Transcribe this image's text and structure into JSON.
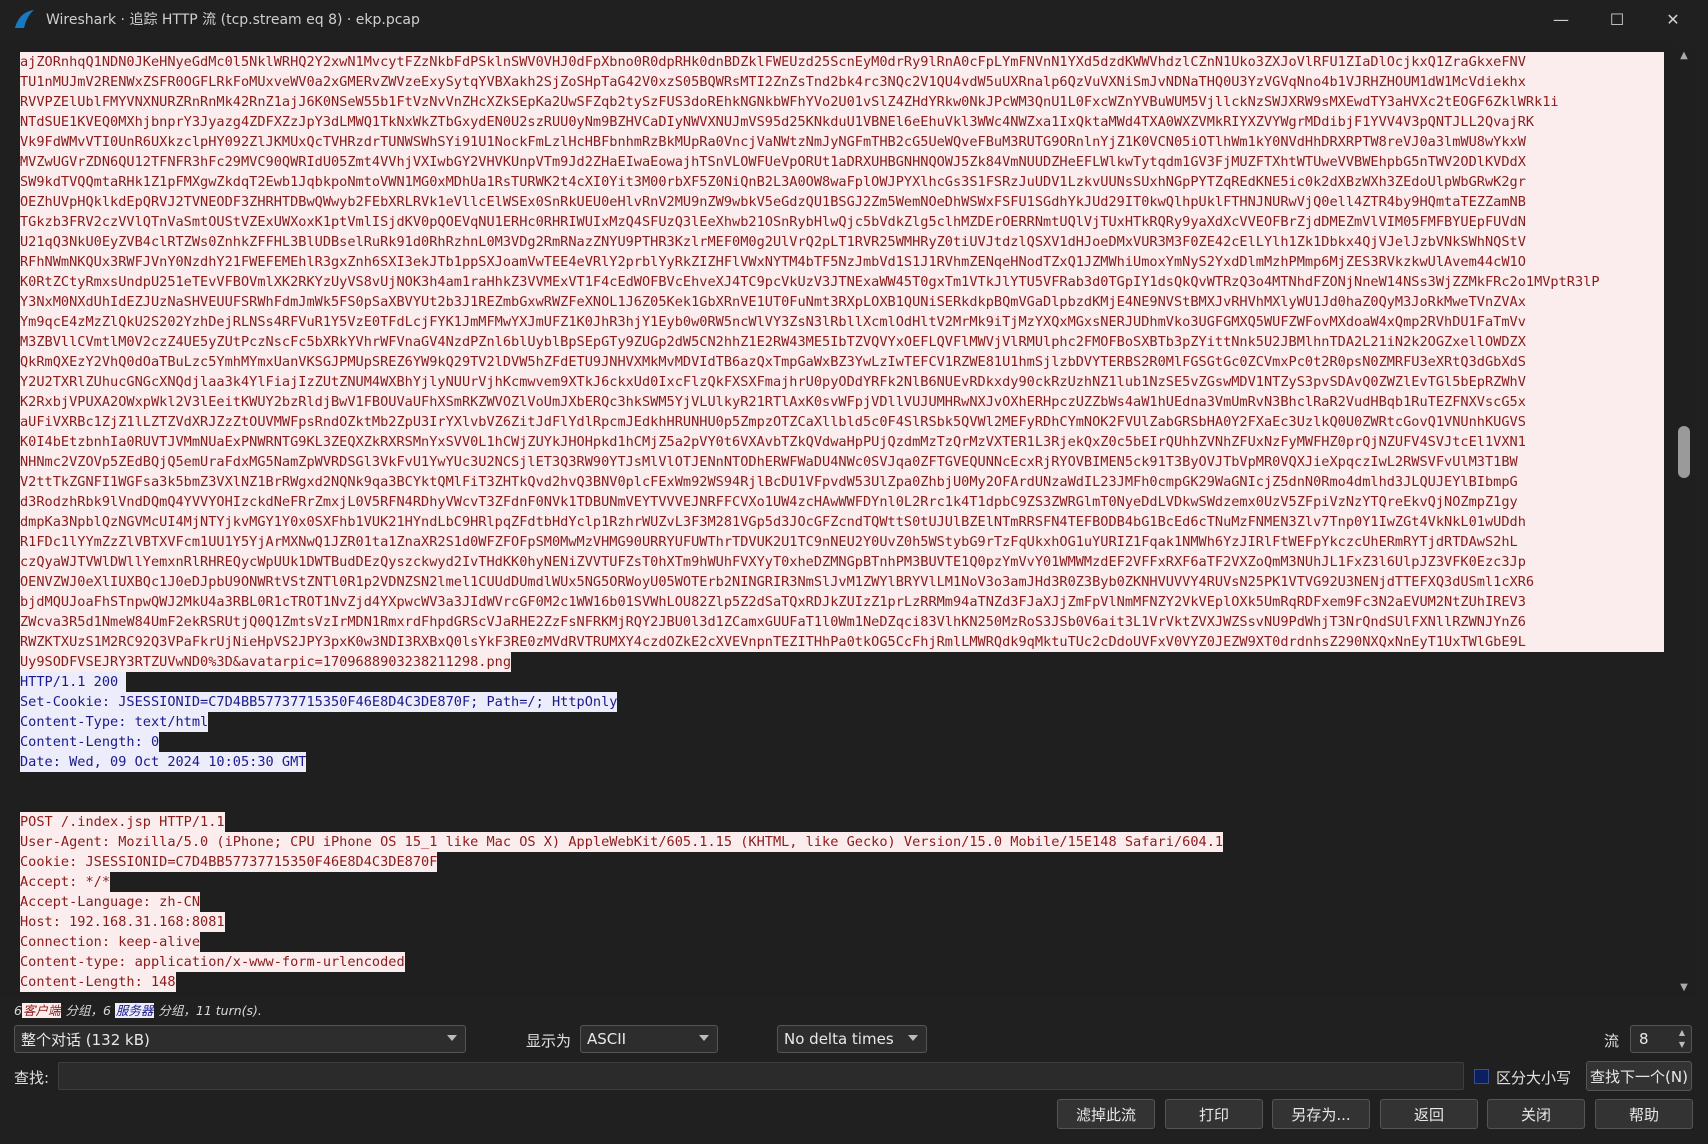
{
  "window": {
    "title": "Wireshark · 追踪 HTTP 流 (tcp.stream eq 8) · ekp.pcap",
    "minimize": "—",
    "maximize": "☐",
    "close": "✕"
  },
  "stream": {
    "client_body_lines": [
      "ajZORnhqQ1NDN0JKeHNyeGdMc0l5NklWRHQ2Y2xwN1MvcytFZzNkbFdPSklnSWV0VHJ0dFpXbno0R0dpRHk0dnBDZklFWEUzd25ScnEyM0drRy9lRnA0cFpLYmFNVnN1YXd5dzdKWWVhdzlCZnN1Uko3ZXJoVlRFU1ZIaDlOcjkxQ1ZraGkxeFNV",
      "TU1nMUJmV2RENWxZSFR0OGFLRkFoMUxveWV0a2xGMERvZWVzeExySytqYVBXakh2SjZoSHpTaG42V0xzS05BQWRsMTI2ZnZsTnd2bk4rc3NQc2V1QU4vdW5uUXRnalp6QzVuVXNiSmJvNDNaTHQ0U3YzVGVqNno4b1VJRHZHOUM1dW1McVdiekhx",
      "RVVPZElUblFMYVNXNURZRnRnMk42RnZ1ajJ6K0NSeW55b1FtVzNvVnZHcXZkSEpKa2UwSFZqb2tySzFUS3doREhkNGNkbWFhYVo2U01vSlZ4ZHdYRkw0NkJPcWM3QnU1L0FxcWZnYVBuWUM5VjllckNzSWJXRW9sMXEwdTY3aHVXc2tEOGF6ZklWRk1i",
      "NTdSUE1KVEQ0MXhjbnprY3Jyazg4ZDFXZzJpY3dLMWQ1TkNxWkZTbGxydEN0U2szRUU0yNm9BZHVCaDIyNWVXNUJmVS95d25KNkduU1VBNEl6eEhuVkl3WWc4NWZxa1IxQktaMWd4TXA0WXZVMkRIYXZVYWgrMDdibjF1YVV4V3pQNTJLL2QvajRK",
      "Vk9FdWMvVTI0UnR6UXkzclpHY092ZlJKMUxQcTVHRzdrTUNWSWhSYi91U1NockFmLzlHcHBFbnhmRzBkMUpRa0VncjVaNWtzNmJyNGFmTHB2cG5UeWQveFBuM3RUTG9ORnlnYjZ1K0VCN05iOTlhWm1kY0NVdHhDRXRPTW8reVJ0a3lmWU8wYkxW",
      "MVZwUGVrZDN6QU12TFNFR3hFc29MVC90QWRIdU05Zmt4VVhjVXIwbGY2VHVKUnpVTm9Jd2ZHaEIwaEowajhTSnVLOWFUeVpORUt1aDRXUHBGNHNQOWJ5Zk84VmNUUDZHeEFLWlkwTytqdm1GV3FjMUZFTXhtWTUweVVBWEhpbG5nTWV2ODlKVDdX",
      "SW9kdTVQQmtaRHk1Z1pFMXgwZkdqT2Ewb1JqbkpoNmtoVWN1MG0xMDhUa1RsTURWK2t4cXI0Yit3M00rbXF5Z0NiQnB2L3A0OW8waFplOWJPYXlhcGs3S1FSRzJuUDV1LzkvUUNsSUxhNGpPYTZqREdKNE5ic0k2dXBzWXh3ZEdoUlpWbGRwK2gr",
      "OEZhUVpHQklkdEpQRVJ2TVNEODF3ZHRHTDBwQWwyb2FEbXRLRVk1eVllcElWSEx0SnRkUEU0eHlvRnV2MU9nZW9wbkV5eGdzQU1BSGJ2Zm5WemNOeDhWSWxFSFU1SGdhYkJUd29IT0kwQlhpUklFTHNJNURwVjQ0ell4ZTR4by9HQmtaTEZZamNB",
      "TGkzb3FRV2czVVlQTnVaSmtOUStVZExUWXoxK1ptVmlISjdKV0pQOEVqNU1ERHc0RHRIWUIxMzQ4SFUzQ3lEeXhwb21OSnRybHlwQjc5bVdkZlg5clhMZDErOERRNmtUQlVjTUxHTkRQRy9yaXdXcVVEOFBrZjdDMEZmVlVIM05FMFBYUEpFUVdN",
      "U21qQ3NkU0EyZVB4clRTZWs0ZnhkZFFHL3BlUDBselRuRk91d0RhRzhnL0M3VDg2RmRNazZNYU9PTHR3KzlrMEF0M0g2UlVrQ2pLT1RVR25WMHRyZ0tiUVJtdzlQSXV1dHJoeDMxVUR3M3F0ZE42cElLYlh1Zk1Dbkx4QjVJelJzbVNkSWhNQStV",
      "RFhNWmNKQUx3RWFJVnY0NzdhY21FWEFEMEhlR3gxZnh6SXI3ekJTb1ppSXJoamVwTEE4eVRlY2prblYyRkZIZHFlVWxNYTM4bTF5NzJmbVd1S1J1RVhmZENqeHNodTZxQ1JZMWhiUmoxYmNyS2YxdDlmMzhPMmp6MjZES3RVkzkwUlAvem44cW1O",
      "K0RtZCtyRmxsUndpU251eTEvVFBOVmlXK2RKYzUyVS8vUjNOK3h4am1raHhkZ3VVMExVT1F4cEdWOFBVcEhveXJ4TC9pcVkUzV3JTNExaWW45T0gxTm1VTkJlYTU5VFRab3d0TGpIY1dsQkQvWTRzQ3o4MTNhdFZONjNneW14NSs3WjZZMkFRc2o1MVptR3lP",
      "Y3NxM0NXdUhIdEZJUzNaSHVEUUFSRWhFdmJmWk5FS0pSaXBVYUt2b3J1REZmbGxwRWZFeXNOL1J6Z05Kek1GbXRnVE1UT0FuNmt3RXpLOXB1QUNiSERkdkpBQmVGaDlpbzdKMjE4NE9NVStBMXJvRHVhMXlyWU1Jd0haZ0QyM3JoRkMweTVnZVAx",
      "Ym9qcE4zMzZlQkU2S202YzhDejRLNSs4RFVuR1Y5VzE0TFdLcjFYK1JmMFMwYXJmUFZ1K0JhR3hjY1Eyb0w0RW5ncWlVY3ZsN3lRbllXcmlOdHltV2MrMk9iTjMzYXQxMGxsNERJUDhmVko3UGFGMXQ5WUFZWFovMXdoaW4xQmp2RVhDU1FaTmVv",
      "M3ZBVllCVmtlM0V2czZ4UE5yZUtPczNscFc5bXRkYVhrWFVnaGV4NzdPZnl6blUyblBpSEpGTy9ZUGp2dW5CN2hhZ1E2RW43ME5IbTZVQVYxOEFLQVFlMWVjVlRMUlphc2FMOFBoSXBTb3pZYittNnk5U2JBMlhnTDA2L21iN2k2OGZxellOWDZX",
      "QkRmQXEzY2VhQ0dOaTBuLzc5YmhMYmxUanVKSGJPMUpSREZ6YW9kQ29TV2lDVW5hZFdETU9JNHVXMkMvMDVIdTB6azQxTmpGaWxBZ3YwLzIwTEFCV1RZWE81U1hmSjlzbDVYTERBS2R0MlFGSGtGc0ZCVmxPc0t2R0psN0ZMRFU3eXRtQ3dGbXdS",
      "Y2U2TXRlZUhucGNGcXNQdjlaa3k4YlFiajIzZUtZNUM4WXBhYjlyNUUrVjhKcmwvem9XTkJ6ckxUd0IxcFlzQkFXSXFmajhrU0pyODdYRFk2NlB6NUEvRDkxdy90ckRzUzhNZ1lub1NzSE5vZGswMDV1NTZyS3pvSDAvQ0ZWZlEvTGl5bEpRZWhV",
      "K2RxbjVPUXA2OWxpWkl2V3lEeitKWUY2bzRldjBwV1FBOUVaUFhXSmRKZWVOZlVoUmJXbERQc3hkSWM5YjVLUlkyR21RTlAxK0svWFpjVDllVUJUMHRwNXJvOXhERHpczUZZbWs4aW1hUEdna3VmUmRvN3BhclRaR2VudHBqb1RuTEZFNXVscG5x",
      "aUFiVXRBc1ZjZ1lLZTZVdXRJZzZtOUVMWFpsRndOZktMb2ZpU3IrYXlvbVZ6ZitJdFlYdlRpcmJEdkhHRUNHU0p5ZmpzOTZCaXllbld5c0F4SlRSbk5QVWl2MEFyRDhCYmNOK2FVUlZabGRSbHA0Y2FXaEc3UzlkQ0U0ZWRtcGovQ1VNUnhKUGVS",
      "K0I4bEtzbnhIa0RUVTJVMmNUaExPNWRNTG9KL3ZEQXZkRXRSMnYxSVV0L1hCWjZUYkJHOHpkd1hCMjZ5a2pVY0t6VXAvbTZkQVdwaHpPUjQzdmMzTzQrMzVXTER1L3RjekQxZ0c5bEIrQUhhZVNhZFUxNzFyMWFHZ0prQjNZUFV4SVJtcEl1VXN1",
      "NHNmc2VZOVp5ZEdBQjQ5emUraFdxMG5NamZpWVRDSGl3VkFvU1YwYUc3U2NCSjlET3Q3RW90YTJsMlVlOTJENnNTODhERWFWaDU4NWc0SVJqa0ZFTGVEQUNNcEcxRjRYOVBIMEN5ck91T3ByOVJTbVpMR0VQXJieXpqczIwL2RWSVFvUlM3T1BW",
      "V2ttTkZGNFI1WGFsa3k5bmZ3VXlNZ1BrRWgxd2NQNk9qa3BCYktQMlFiT3ZHTkQvd2hvQ3BNV0plcFExWm92WS94RjlBcDU1VFpvdW53UlZpa0ZhbjU0My2OFArdUNzaWdIL23JMFh0cmpGK29WaGNIcjZ5dnN0Rmo4dmlhd3JLQUJEYlBIbmpG",
      "d3RodzhRbk9lVndDQmQ4YVVYOHIzckdNeFRrZmxjL0V5RFN4RDhyVWcvT3ZFdnF0NVk1TDBUNmVEYTVVVEJNRFFCVXo1UW4zcHAwWWFDYnl0L2Rrc1k4T1dpbC9ZS3ZWRGlmT0NyeDdLVDkwSWdzemx0UzV5ZFpiVzNzYTQreEkvQjNOZmpZ1gy",
      "dmpKa3NpblQzNGVMcUI4MjNTYjkvMGY1Y0x0SXFhb1VUK21HYndLbC9HRlpqZFdtbHdYclp1RzhrWUZvL3F3M281VGp5d3JOcGFZcndTQWttS0tUJUlBZElNTmRRSFN4TEFBODB4bG1BcEd6cTNuMzFNMEN3Zlv7Tnp0Y1IwZGt4VkNkL01wUDdh",
      "R1FDc1lYYmZzZlVBTXVFcm1UU1Y5YjArMXNwQ1JZR01ta1ZnaXR2S1d0WFZFOFpSM0MwMzVHMG90URRYUFUWThrTDVUK2U1TC9nNEU2Y0UvZ0h5WStybG9rTzFqUkxhOG1uYURIZ1Fqak1NMWh6YzJIRlFtWEFpYkczcUhERmRYTjdRTDAwS2hL",
      "czQyaWJTVWlDWllYemxnRlRHREQycWpUUk1DWTBudDEzQyszckwyd2IvTHdKK0hyNENiZVVTUFZsT0hXTm9hWUhFVXYyT0xheDZMNGpBTnhPM3BUVTE1Q0pzYmVvY01WMWMzdEF2VFFxRXF6aTF2VXZoQmM3NUhJL1FxZ3l6UlpJZ3VFK0Ezc3Jp",
      "OENVZWJ0eXlIUXBQc1J0eDJpbU9ONWRtVStZNTl0R1p2VDNZSN2lmel1CUUdDUmdlWUx5NG5ORWoyU05WOTErb2NINGRIR3NmSlJvM1ZWYlBRYVlLM1NoV3o3amJHd3R0Z3Byb0ZKNHVUVVY4RUVsN25PK1VTVG92U3NENjdTTEFXQ3dUSml1cXR6",
      "bjdMQUJoaFhSTnpwQWJ2MkU4a3RBL0R1cTROT1NvZjd4YXpwcWV3a3JIdWVrcGF0M2c1WW16b01SVWhLOU82Zlp5Z2dSaTQxRDJkZUIzZ1prLzRRMm94aTNZd3FJaXJjZmFpVlNmMFNZY2VkVEplOXk5UmRqRDFxem9Fc3N2aEVUM2NtZUhIREV3",
      "ZWcva3R5d1NmeW84UmF2ekRSRUtjQ0Q1ZmtsVzIrMDN1RmxrdFhpdGRScVJaRHE2ZzFsNFRKMjRQY2JBU0l3d1ZCamxGUUFaT1l0Wm1NeDZqci83VlhKN250MzRoS3JSb0V6ait3L1VrVktZVXJWZSsvNU9PdWhjT3NrQndSUlFXNllRZWNJYnZ6",
      "RWZKTXUzS1M2RC92Q3VPaFkrUjNieHpVS2JPY3pxK0w3NDI3RXBxQ0lsYkF3RE0zMVdRVTRUMXY4czdOZkE2cXVEVnpnTEZITHhPa0tkOG5CcFhjRmlLMWRQdk9qMktuTUc2cDdoUVFxV0VYZ0JEZW9XT0drdnhsZ290NXQxNnEyT1UxTWlGbE9L",
      "Uy9SODFVSEJRY3RTZUVwND0%3D&avatarpic=1709688903238211298.png"
    ],
    "server_response": [
      "HTTP/1.1 200 ",
      "Set-Cookie: JSESSIONID=C7D4BB57737715350F46E8D4C3DE870F; Path=/; HttpOnly",
      "Content-Type: text/html",
      "Content-Length: 0",
      "Date: Wed, 09 Oct 2024 10:05:30 GMT"
    ],
    "client_request": [
      "POST /.index.jsp HTTP/1.1",
      "User-Agent: Mozilla/5.0 (iPhone; CPU iPhone OS 15_1 like Mac OS X) AppleWebKit/605.1.15 (KHTML, like Gecko) Version/15.0 Mobile/15E148 Safari/604.1",
      "Cookie: JSESSIONID=C7D4BB57737715350F46E8D4C3DE870F",
      "Accept: */*",
      "Accept-Language: zh-CN",
      "Host: 192.168.31.168:8081",
      "Connection: keep-alive",
      "Content-type: application/x-www-form-urlencoded",
      "Content-Length: 148"
    ]
  },
  "status": {
    "client_count": "6",
    "client_tag": "客户端",
    "mid": " 分组，6 ",
    "server_tag": "服务器",
    "tail": " 分组，11 turn(s)."
  },
  "controls": {
    "conversation": "整个对话 (132 kB)",
    "show_as_label": "显示为",
    "show_as_value": "ASCII",
    "delta": "No delta times",
    "stream_label": "流",
    "stream_value": "8",
    "find_label": "查找:",
    "find_value": "",
    "case_label": "区分大小写",
    "find_next": "查找下一个(N)"
  },
  "buttons": {
    "filter_out": "滤掉此流",
    "print": "打印",
    "save_as": "另存为...",
    "back": "返回",
    "close": "关闭",
    "help": "帮助"
  },
  "colors": {
    "client_bg": "#fbeded",
    "client_fg": "#8c1b1b",
    "server_bg": "#ececfb",
    "server_fg": "#1a1a8c",
    "window_bg": "#202020"
  }
}
